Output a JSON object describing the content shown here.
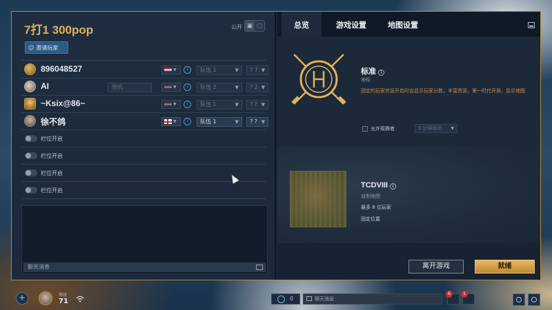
{
  "lobby": {
    "title": "7打1 300pop",
    "public_label": "公开",
    "public_on": "",
    "public_off": "",
    "invite_label": "邀请玩家"
  },
  "players": [
    {
      "name": "896048527",
      "civ": "",
      "team": "队伍 1",
      "pop": "? 7"
    },
    {
      "name": "AI",
      "civ": "随机",
      "team": "队伍 2",
      "pop": "? 2"
    },
    {
      "name": "~Ksix@86~",
      "civ": "",
      "team": "队伍 1",
      "pop": "? ?"
    },
    {
      "name": "徐不鸽",
      "civ": "",
      "team": "队伍 1",
      "pop": "? ?"
    }
  ],
  "open_slots": [
    {
      "label": "栏位开启"
    },
    {
      "label": "栏位开启"
    },
    {
      "label": "栏位开启"
    },
    {
      "label": "栏位开启"
    }
  ],
  "chat": {
    "placeholder": "聊天消息"
  },
  "tabs": [
    {
      "label": "总览"
    },
    {
      "label": "游戏设置"
    },
    {
      "label": "地图设置"
    }
  ],
  "mode": {
    "title": "标准",
    "subtitle": "地标",
    "description": "固定的玩家信息开启时会显示玩家分数，丰富资源，第一时代开局，显示地图",
    "spectator_label": "允许观赛者",
    "spectator_select": "5 分钟延迟"
  },
  "map": {
    "title": "TCDVIII",
    "subtitle": "自制地图",
    "players": "最多 8 位玩家",
    "position": "固定位置"
  },
  "actions": {
    "leave_label": "离开游戏",
    "ready_label": "就绪"
  },
  "bottom": {
    "plus": "+",
    "level_label": "等级",
    "level_value": "71",
    "friends_count": "0",
    "global_chat_placeholder": "聊天消息",
    "notif1_count": "6",
    "notif2_count": "1"
  },
  "colors": {
    "accent_gold": "#e1b25a",
    "ready_gold": "#e8b860",
    "invite_blue": "#2a5a86",
    "description_orange": "#d08a4a"
  }
}
